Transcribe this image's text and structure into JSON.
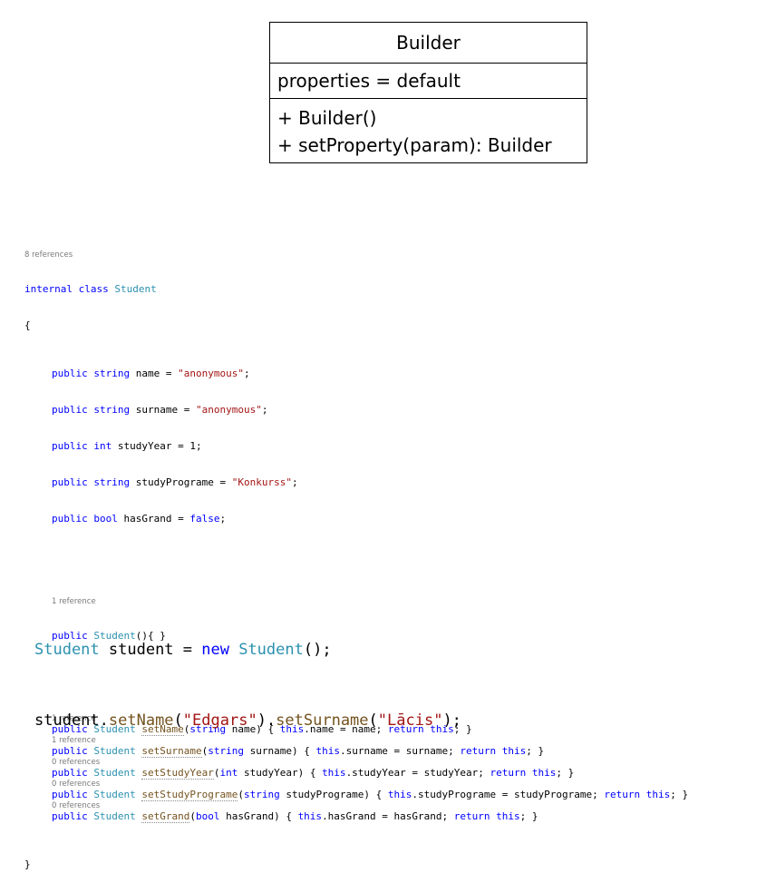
{
  "uml": {
    "class_name": "Builder",
    "attribute": "properties = default",
    "operations": [
      "+ Builder()",
      "+ setProperty(param): Builder"
    ]
  },
  "code": {
    "class_refs": "8 references",
    "kw_internal": "internal",
    "kw_class": "class",
    "class_name": "Student",
    "open_brace": "{",
    "close_brace": "}",
    "fields": [
      {
        "mod": "public",
        "type": "string",
        "rest": " name = ",
        "value": "\"anonymous\"",
        "end": ";"
      },
      {
        "mod": "public",
        "type": "string",
        "rest": " surname = ",
        "value": "\"anonymous\"",
        "end": ";"
      },
      {
        "mod": "public",
        "type": "int",
        "rest": " studyYear = 1;",
        "value": "",
        "end": ""
      },
      {
        "mod": "public",
        "type": "string",
        "rest": " studyPrograme = ",
        "value": "\"Konkurss\"",
        "end": ";"
      },
      {
        "mod": "public",
        "type": "bool",
        "rest": " hasGrand = ",
        "value": "false",
        "end": ";"
      }
    ],
    "ctor_refs": "1 reference",
    "ctor_rest": "(){ }",
    "methods": [
      {
        "refs": "1 reference",
        "name": "setName",
        "ptype": "string",
        "pname": " name) { ",
        "body": ".name = name; "
      },
      {
        "refs": "1 reference",
        "name": "setSurname",
        "ptype": "string",
        "pname": " surname) { ",
        "body": ".surname = surname; "
      },
      {
        "refs": "0 references",
        "name": "setStudyYear",
        "ptype": "int",
        "pname": " studyYear) { ",
        "body": ".studyYear = studyYear; "
      },
      {
        "refs": "0 references",
        "name": "setStudyPrograme",
        "ptype": "string",
        "pname": " studyPrograme) { ",
        "body": ".studyPrograme = studyPrograme; "
      },
      {
        "refs": "0 references",
        "name": "setGrand",
        "ptype": "bool",
        "pname": " hasGrand) { ",
        "body": ".hasGrand = hasGrand; "
      }
    ],
    "kw_public": "public",
    "kw_this": "this",
    "kw_return": "return",
    "ret_end": "; }",
    "paren": "("
  },
  "usage": {
    "line1_type": "Student",
    "line1_var": " student = ",
    "line1_new": "new",
    "line1_ctor": " Student",
    "line1_end": "();",
    "line2_obj": "student.",
    "line2_m1": "setName",
    "line2_a1": "(",
    "line2_s1": "\"Edgars\"",
    "line2_b1": ").",
    "line2_m2": "setSurname",
    "line2_a2": "(",
    "line2_s2": "\"Lācis\"",
    "line2_end": ");"
  }
}
